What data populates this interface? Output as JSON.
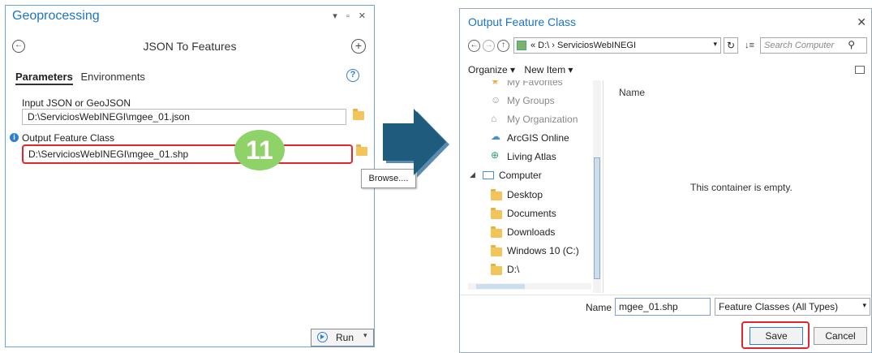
{
  "geoprocessing": {
    "title": "Geoprocessing",
    "window_controls": "▾ ▫ ✕",
    "tool_title": "JSON To Features",
    "tabs": [
      "Parameters",
      "Environments"
    ],
    "input_label": "Input JSON or GeoJSON",
    "input_value": "D:\\ServiciosWebINEGI\\mgee_01.json",
    "output_label": "Output Feature Class",
    "output_value": "D:\\ServiciosWebINEGI\\mgee_01.shp",
    "step_badge": "11",
    "browse_tooltip": "Browse....",
    "run_label": "Run"
  },
  "dialog": {
    "title": "Output Feature Class",
    "address": "« D:\\ › ServiciosWebINEGI",
    "search_placeholder": "Search Computer",
    "toolbar": {
      "organize": "Organize ▾",
      "new_item": "New Item ▾"
    },
    "nav_items": [
      {
        "label": "My Favorites"
      },
      {
        "label": "My Groups"
      },
      {
        "label": "My Organization"
      },
      {
        "label": "ArcGIS Online"
      },
      {
        "label": "Living Atlas"
      },
      {
        "label": "Computer"
      },
      {
        "label": "Desktop"
      },
      {
        "label": "Documents"
      },
      {
        "label": "Downloads"
      },
      {
        "label": "Windows 10 (C:)"
      },
      {
        "label": "D:\\"
      }
    ],
    "column_name": "Name",
    "empty_message": "This container is empty.",
    "name_label": "Name",
    "name_value": "mgee_01.shp",
    "file_type": "Feature Classes (All Types)",
    "save_label": "Save",
    "cancel_label": "Cancel"
  },
  "colors": {
    "accent": "#1b74c4",
    "highlight": "#e4262c",
    "badge": "#8fd268",
    "arrow": "#1f5b7c",
    "folder": "#f2c45a"
  }
}
